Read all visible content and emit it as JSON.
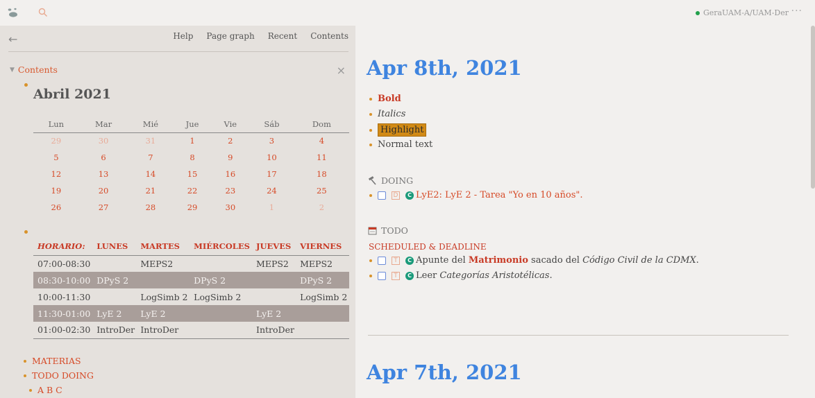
{
  "topbar": {
    "graph_name": "GeraUAM-A/UAM-Der",
    "more": "···"
  },
  "sidebar": {
    "nav": [
      "Help",
      "Page graph",
      "Recent",
      "Contents"
    ],
    "contents_label": "Contents",
    "calendar": {
      "title": "Abril 2021",
      "days": [
        "Lun",
        "Mar",
        "Mié",
        "Jue",
        "Vie",
        "Sáb",
        "Dom"
      ],
      "rows": [
        [
          "29",
          "30",
          "31",
          "1",
          "2",
          "3",
          "4"
        ],
        [
          "5",
          "6",
          "7",
          "8",
          "9",
          "10",
          "11"
        ],
        [
          "12",
          "13",
          "14",
          "15",
          "16",
          "17",
          "18"
        ],
        [
          "19",
          "20",
          "21",
          "22",
          "23",
          "24",
          "25"
        ],
        [
          "26",
          "27",
          "28",
          "29",
          "30",
          "1",
          "2"
        ]
      ]
    },
    "schedule": {
      "headers": [
        "HORARIO:",
        "LUNES",
        "MARTES",
        "MIÉRCOLES",
        "JUEVES",
        "VIERNES"
      ],
      "rows": [
        [
          "07:00-08:30",
          "",
          "MEPS2",
          "",
          "MEPS2",
          "MEPS2"
        ],
        [
          "08:30-10:00",
          "DPyS 2",
          "",
          "DPyS 2",
          "",
          "DPyS 2"
        ],
        [
          "10:00-11:30",
          "",
          "LogSimb 2",
          "LogSimb 2",
          "",
          "LogSimb 2"
        ],
        [
          "11:30-01:00",
          "LyE 2",
          "LyE 2",
          "",
          "LyE 2",
          ""
        ],
        [
          "01:00-02:30",
          "IntroDer",
          "IntroDer",
          "",
          "IntroDer",
          ""
        ]
      ]
    },
    "links": [
      "MATERIAS",
      "TODO DOING",
      "A B C"
    ]
  },
  "journal": {
    "day1": {
      "title": "Apr 8th, 2021",
      "bold": "Bold",
      "italics": "Italics",
      "highlight": "Highlight",
      "normal": "Normal text",
      "doing_label": "DOING",
      "doing_marker": "D",
      "doing_item": "LyE2: LyE 2 - Tarea \"Yo en 10 años\".",
      "todo_label": "TODO",
      "scheduled_label": "SCHEDULED & DEADLINE",
      "todo_marker": "T",
      "todo1_a": "Apunte del ",
      "todo1_b": "Matrimonio",
      "todo1_c": " sacado del ",
      "todo1_d": "Código Civil de la CDMX",
      "todo1_e": ".",
      "todo2_a": "Leer ",
      "todo2_b": "Categorías Aristotélicas",
      "todo2_c": "."
    },
    "day2": {
      "title": "Apr 7th, 2021"
    }
  },
  "colors": {
    "accent": "#3f84df",
    "link": "#d64a27",
    "highlight": "#d18a16",
    "bullet": "#d8922b"
  }
}
